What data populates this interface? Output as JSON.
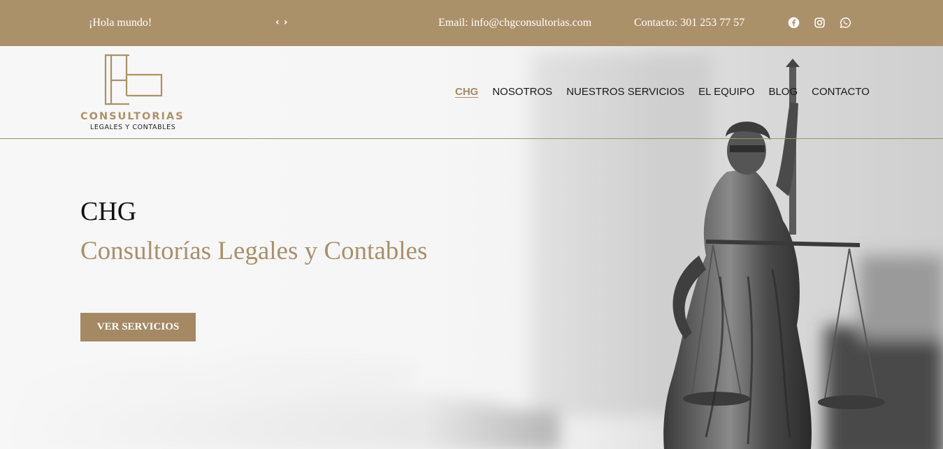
{
  "topbar": {
    "greeting": "¡Hola mundo!",
    "prev_arrow": "‹",
    "next_arrow": "›",
    "email": "Email: info@chgconsultorias.com",
    "phone": "Contacto: 301 253 77 57",
    "socials": [
      "facebook-icon",
      "instagram-icon",
      "whatsapp-icon"
    ],
    "background_color": "#ab916a"
  },
  "logo": {
    "wordmark": "CONSULTORIAS",
    "tagline": "LEGALES Y CONTABLES",
    "accent_color": "#ab916a"
  },
  "nav": {
    "items": [
      {
        "label": "CHG",
        "active": true
      },
      {
        "label": "NOSOTROS",
        "active": false
      },
      {
        "label": "NUESTROS SERVICIOS",
        "active": false
      },
      {
        "label": "EL EQUIPO",
        "active": false
      },
      {
        "label": "BLOG",
        "active": false
      },
      {
        "label": "CONTACTO",
        "active": false
      }
    ],
    "active_color": "#a58a66"
  },
  "hero": {
    "title": "CHG",
    "subtitle": "Consultorías Legales y Contables",
    "cta_label": "VER SERVICIOS",
    "cta_color": "#a48964",
    "background_image": "justice-statue-image"
  }
}
